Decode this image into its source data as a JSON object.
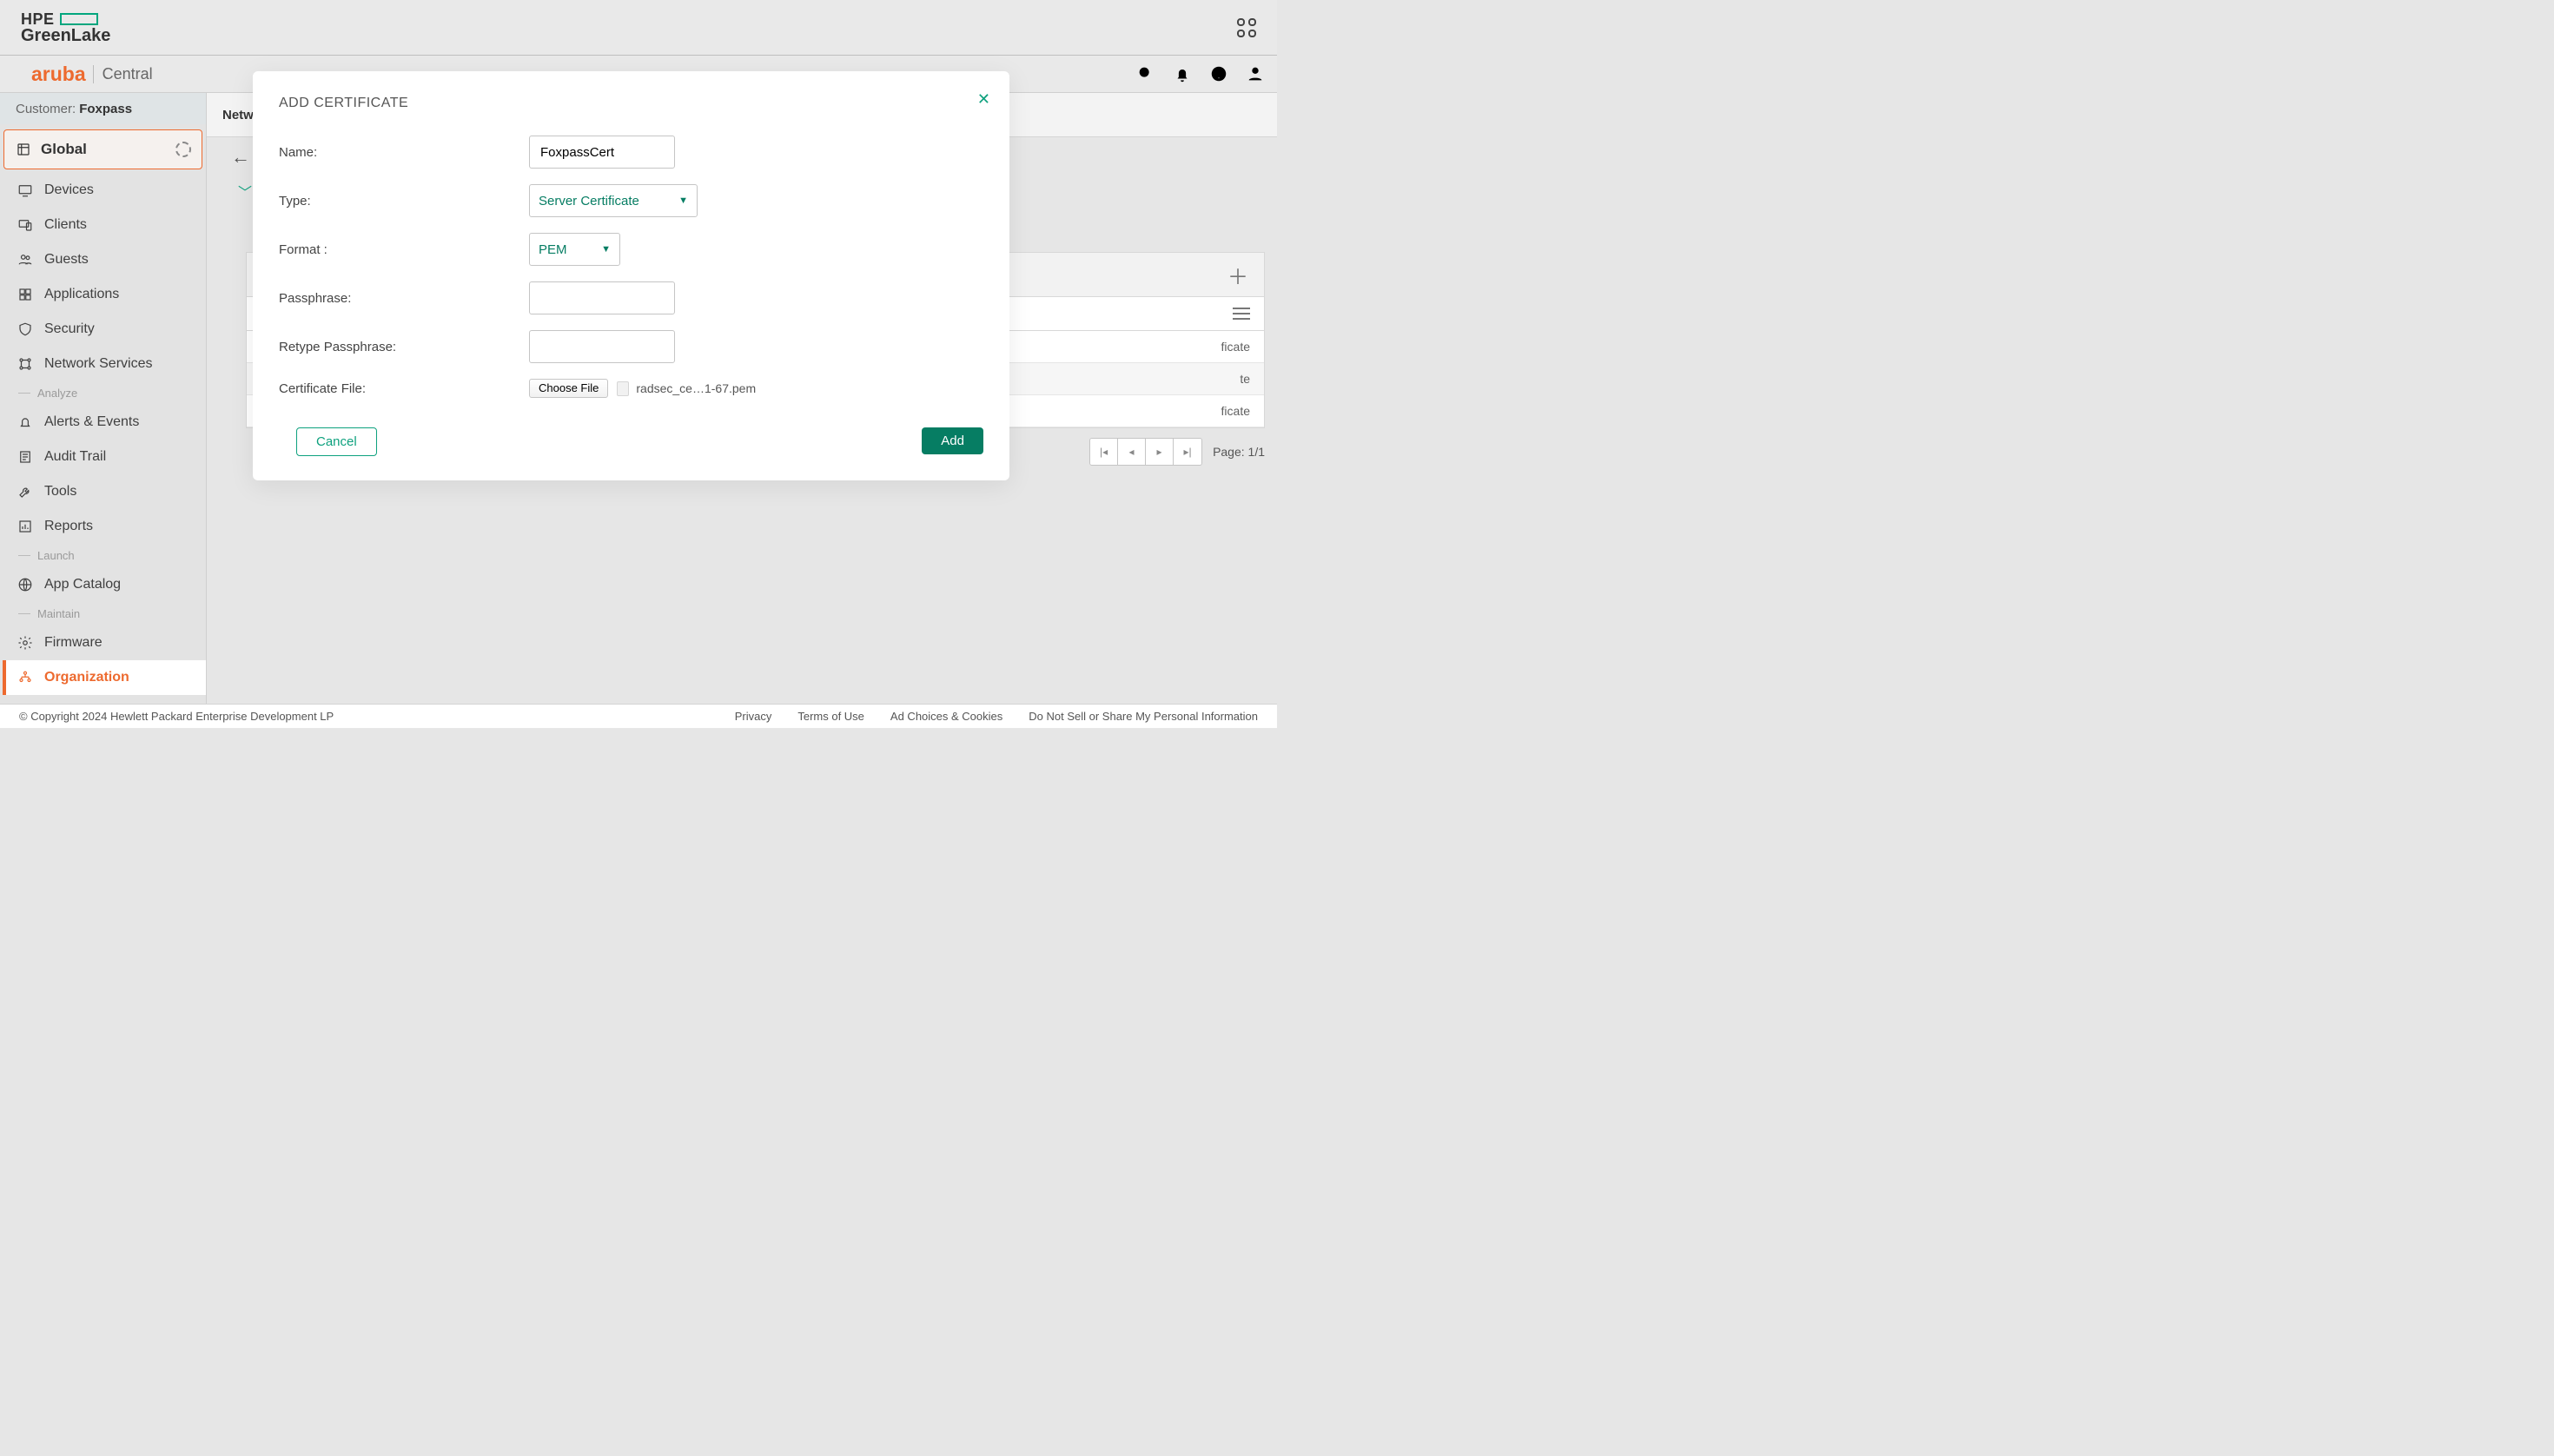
{
  "hpe": {
    "brand_top": "HPE",
    "brand_bottom": "GreenLake"
  },
  "aruba": {
    "brand": "aruba",
    "product": "Central"
  },
  "customer": {
    "label": "Customer:",
    "name": "Foxpass"
  },
  "scope": {
    "label": "Global"
  },
  "sidebar": {
    "items": [
      {
        "label": "Devices"
      },
      {
        "label": "Clients"
      },
      {
        "label": "Guests"
      },
      {
        "label": "Applications"
      },
      {
        "label": "Security"
      },
      {
        "label": "Network Services"
      }
    ],
    "sections": {
      "analyze": "Analyze",
      "launch": "Launch",
      "maintain": "Maintain"
    },
    "analyze": [
      {
        "label": "Alerts & Events"
      },
      {
        "label": "Audit Trail"
      },
      {
        "label": "Tools"
      },
      {
        "label": "Reports"
      }
    ],
    "launch": [
      {
        "label": "App Catalog"
      }
    ],
    "maintain": [
      {
        "label": "Firmware"
      },
      {
        "label": "Organization"
      }
    ]
  },
  "main": {
    "breadcrumb": "Netw",
    "rows": [
      "ficate",
      "te",
      "ficate"
    ],
    "page_label": "Page: 1/1"
  },
  "modal": {
    "title": "ADD CERTIFICATE",
    "name_label": "Name:",
    "name_value": "FoxpassCert",
    "type_label": "Type:",
    "type_value": "Server Certificate",
    "format_label": "Format :",
    "format_value": "PEM",
    "pass_label": "Passphrase:",
    "pass2_label": "Retype Passphrase:",
    "file_label": "Certificate File:",
    "choose_file": "Choose File",
    "file_name": "radsec_ce…1-67.pem",
    "cancel": "Cancel",
    "add": "Add"
  },
  "footer": {
    "copyright": "© Copyright 2024 Hewlett Packard Enterprise Development LP",
    "links": [
      "Privacy",
      "Terms of Use",
      "Ad Choices & Cookies",
      "Do Not Sell or Share My Personal Information"
    ]
  }
}
